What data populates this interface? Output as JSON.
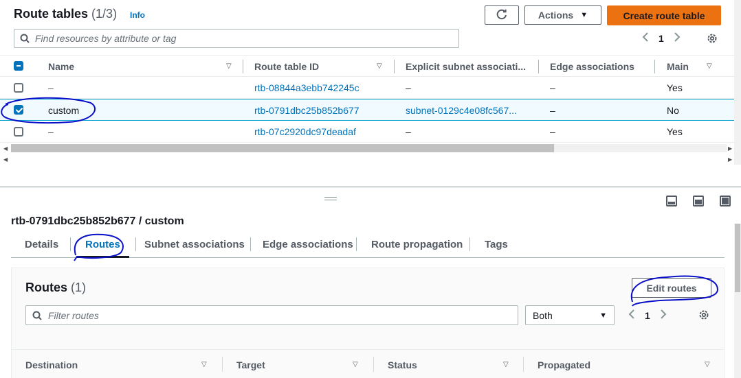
{
  "header": {
    "title": "Route tables",
    "count": "(1/3)",
    "info": "Info",
    "actions_label": "Actions",
    "create_label": "Create route table"
  },
  "search": {
    "placeholder": "Find resources by attribute or tag"
  },
  "pager": {
    "page": "1"
  },
  "table": {
    "columns": [
      "Name",
      "Route table ID",
      "Explicit subnet associati...",
      "Edge associations",
      "Main"
    ],
    "rows": [
      {
        "name": "–",
        "id": "rtb-08844a3ebb742245c",
        "subnet": "–",
        "edge": "–",
        "main": "Yes",
        "selected": false
      },
      {
        "name": "custom",
        "id": "rtb-0791dbc25b852b677",
        "subnet": "subnet-0129c4e08fc567...",
        "edge": "–",
        "main": "No",
        "selected": true
      },
      {
        "name": "–",
        "id": "rtb-07c2920dc97deadaf",
        "subnet": "–",
        "edge": "–",
        "main": "Yes",
        "selected": false
      }
    ]
  },
  "detail": {
    "title": "rtb-0791dbc25b852b677 / custom",
    "tabs": [
      "Details",
      "Routes",
      "Subnet associations",
      "Edge associations",
      "Route propagation",
      "Tags"
    ],
    "active_tab": "Routes"
  },
  "routes": {
    "title": "Routes",
    "count": "(1)",
    "edit_label": "Edit routes",
    "filter_placeholder": "Filter routes",
    "select_value": "Both",
    "page": "1",
    "columns": [
      "Destination",
      "Target",
      "Status",
      "Propagated"
    ]
  },
  "colors": {
    "accent": "#0073bb",
    "primary_button": "#ec7211",
    "annotation_ink": "#0a10c8"
  },
  "icons": [
    "refresh-icon",
    "caret-down-icon",
    "search-icon",
    "chevron-left-icon",
    "chevron-right-icon",
    "gear-icon",
    "sort-caret-icon",
    "panel-layout-icon",
    "resize-grip-icon"
  ]
}
